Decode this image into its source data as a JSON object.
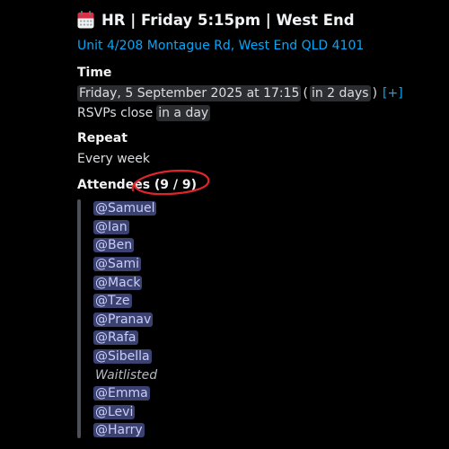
{
  "event": {
    "icon": "calendar-icon",
    "title": "HR | Friday 5:15pm | West End",
    "address": "Unit 4/208 Montague Rd, West End QLD 4101"
  },
  "time": {
    "label": "Time",
    "datetime": "Friday, 5 September 2025 at 17:15",
    "relative": "in 2 days",
    "paren_open": "(",
    "paren_close": ")",
    "add_link": "[+]",
    "rsvp_prefix": "RSVPs close",
    "rsvp_relative": "in a day"
  },
  "repeat": {
    "label": "Repeat",
    "value": "Every week"
  },
  "attendees": {
    "label": "Attendees (9 / 9)",
    "confirmed": [
      "@Samuel",
      "@Ian",
      "@Ben",
      "@Sami",
      "@Mack",
      "@Tze",
      "@Pranav",
      "@Rafa",
      "@Sibella"
    ],
    "waitlisted_label": "Waitlisted",
    "waitlisted": [
      "@Emma",
      "@Levi",
      "@Harry"
    ]
  },
  "colors": {
    "background": "#000000",
    "link": "#00a8fc",
    "mention_bg": "#3c4270",
    "mention_text": "#c9cdfb",
    "annotation": "#e0242c"
  }
}
